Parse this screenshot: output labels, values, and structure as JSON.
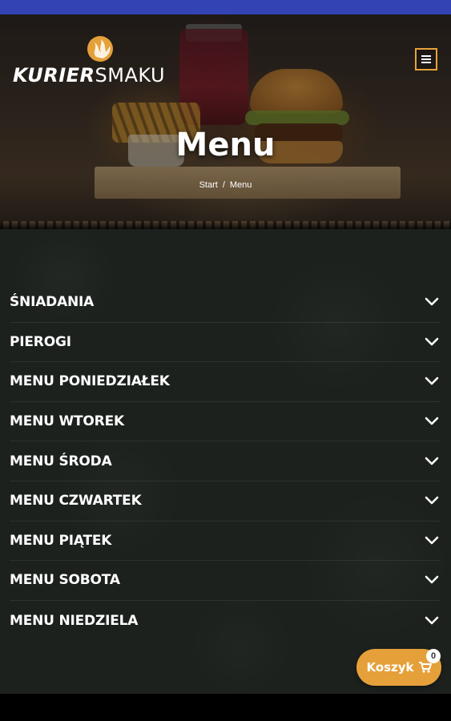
{
  "brand": {
    "name_bold": "KURIER",
    "name_light": "SMAKU",
    "accent_color": "#e5a03a",
    "logo_icon": "flame-icon"
  },
  "header": {
    "menu_icon": "hamburger-icon"
  },
  "hero": {
    "title": "Menu",
    "breadcrumb": [
      "Start",
      "Menu"
    ],
    "breadcrumb_separator": "/"
  },
  "menu_categories": [
    {
      "label": "ŚNIADANIA"
    },
    {
      "label": "PIEROGI"
    },
    {
      "label": "MENU PONIEDZIAŁEK"
    },
    {
      "label": "MENU WTOREK"
    },
    {
      "label": "MENU ŚRODA"
    },
    {
      "label": "MENU CZWARTEK"
    },
    {
      "label": "MENU PIĄTEK"
    },
    {
      "label": "MENU SOBOTA"
    },
    {
      "label": "MENU NIEDZIELA"
    }
  ],
  "cart": {
    "label": "Koszyk",
    "count": "0",
    "icon": "cart-icon"
  },
  "colors": {
    "status_bar": "#3443b3",
    "content_bg": "#1d211e"
  }
}
